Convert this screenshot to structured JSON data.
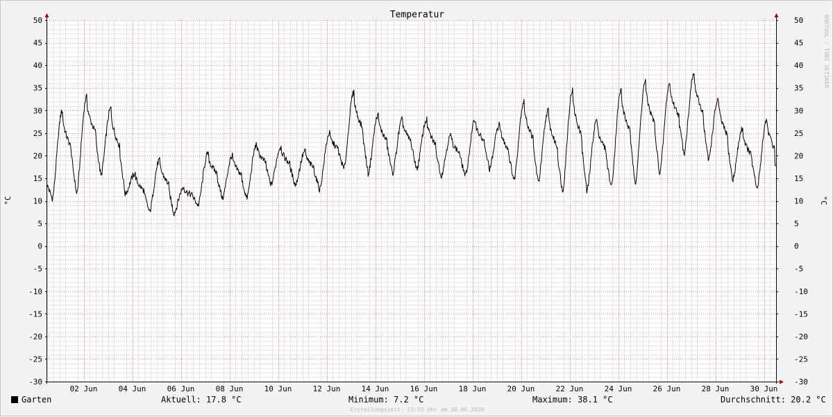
{
  "chart_data": {
    "type": "line",
    "title": "Temperatur",
    "ylabel": "°C",
    "ylim": [
      -30,
      50
    ],
    "yticks": [
      "-30",
      "-25",
      "-20",
      "-15",
      "-10",
      "-5",
      "0",
      "5",
      "10",
      "15",
      "20",
      "25",
      "30",
      "35",
      "40",
      "45",
      "50"
    ],
    "xlim_days": [
      0,
      30
    ],
    "xticks": [
      "02 Jun",
      "04 Jun",
      "06 Jun",
      "08 Jun",
      "10 Jun",
      "12 Jun",
      "14 Jun",
      "16 Jun",
      "18 Jun",
      "20 Jun",
      "22 Jun",
      "24 Jun",
      "26 Jun",
      "28 Jun",
      "30 Jun"
    ],
    "grid": true,
    "series": [
      {
        "name": "Garten",
        "color": "#000000",
        "daily": [
          {
            "date": "01 Jun",
            "min": 10.5,
            "max": 30.0
          },
          {
            "date": "02 Jun",
            "min": 11.5,
            "max": 33.0
          },
          {
            "date": "03 Jun",
            "min": 15.5,
            "max": 30.5
          },
          {
            "date": "04 Jun",
            "min": 11.5,
            "max": 16.0
          },
          {
            "date": "05 Jun",
            "min": 7.5,
            "max": 19.0
          },
          {
            "date": "06 Jun",
            "min": 7.2,
            "max": 13.0
          },
          {
            "date": "07 Jun",
            "min": 9.0,
            "max": 20.5
          },
          {
            "date": "08 Jun",
            "min": 10.5,
            "max": 20.0
          },
          {
            "date": "09 Jun",
            "min": 10.5,
            "max": 22.5
          },
          {
            "date": "10 Jun",
            "min": 13.5,
            "max": 22.0
          },
          {
            "date": "11 Jun",
            "min": 13.5,
            "max": 21.0
          },
          {
            "date": "12 Jun",
            "min": 12.5,
            "max": 25.0
          },
          {
            "date": "13 Jun",
            "min": 17.0,
            "max": 34.0
          },
          {
            "date": "14 Jun",
            "min": 16.0,
            "max": 29.0
          },
          {
            "date": "15 Jun",
            "min": 16.0,
            "max": 28.0
          },
          {
            "date": "16 Jun",
            "min": 17.0,
            "max": 28.0
          },
          {
            "date": "17 Jun",
            "min": 15.5,
            "max": 24.5
          },
          {
            "date": "18 Jun",
            "min": 15.5,
            "max": 28.0
          },
          {
            "date": "19 Jun",
            "min": 17.0,
            "max": 27.0
          },
          {
            "date": "20 Jun",
            "min": 14.5,
            "max": 32.0
          },
          {
            "date": "21 Jun",
            "min": 14.0,
            "max": 30.0
          },
          {
            "date": "22 Jun",
            "min": 12.0,
            "max": 34.5
          },
          {
            "date": "23 Jun",
            "min": 12.0,
            "max": 28.0
          },
          {
            "date": "24 Jun",
            "min": 13.0,
            "max": 34.5
          },
          {
            "date": "25 Jun",
            "min": 14.0,
            "max": 36.5
          },
          {
            "date": "26 Jun",
            "min": 16.0,
            "max": 36.0
          },
          {
            "date": "27 Jun",
            "min": 20.5,
            "max": 38.1
          },
          {
            "date": "28 Jun",
            "min": 19.0,
            "max": 32.5
          },
          {
            "date": "29 Jun",
            "min": 14.5,
            "max": 26.0
          },
          {
            "date": "30 Jun",
            "min": 12.5,
            "max": 28.0
          }
        ],
        "current": 17.8
      }
    ]
  },
  "legend": {
    "series_name": "Garten",
    "current": "Aktuell: 17.8 °C",
    "minimum": "Minimum: 7.2 °C",
    "maximum": "Maximum: 38.1 °C",
    "average": "Durchschnitt: 20.2 °C"
  },
  "footer": "Erstellungszeit: 23:55 Uhr am 30.06.2020",
  "watermark": "RRDTOOL / TOBI OETIKER"
}
